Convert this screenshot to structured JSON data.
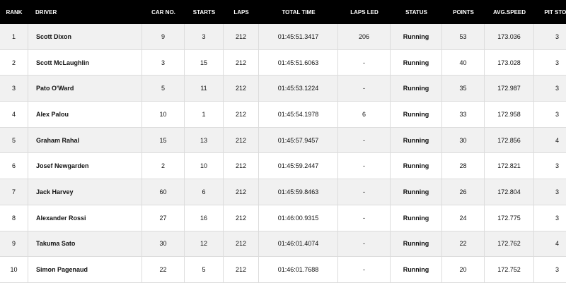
{
  "columns": {
    "rank": "RANK",
    "driver": "DRIVER",
    "car_no": "CAR NO.",
    "starts": "STARTS",
    "laps": "LAPS",
    "total_time": "TOTAL TIME",
    "laps_led": "LAPS LED",
    "status": "STATUS",
    "points": "POINTS",
    "avg_speed": "AVG.SPEED",
    "pit_stop": "PIT STOP"
  },
  "rows": [
    {
      "rank": "1",
      "driver": "Scott Dixon",
      "car_no": "9",
      "starts": "3",
      "laps": "212",
      "total_time": "01:45:51.3417",
      "laps_led": "206",
      "status": "Running",
      "points": "53",
      "avg_speed": "173.036",
      "pit_stop": "3"
    },
    {
      "rank": "2",
      "driver": "Scott McLaughlin",
      "car_no": "3",
      "starts": "15",
      "laps": "212",
      "total_time": "01:45:51.6063",
      "laps_led": "-",
      "status": "Running",
      "points": "40",
      "avg_speed": "173.028",
      "pit_stop": "3"
    },
    {
      "rank": "3",
      "driver": "Pato O'Ward",
      "car_no": "5",
      "starts": "11",
      "laps": "212",
      "total_time": "01:45:53.1224",
      "laps_led": "-",
      "status": "Running",
      "points": "35",
      "avg_speed": "172.987",
      "pit_stop": "3"
    },
    {
      "rank": "4",
      "driver": "Alex Palou",
      "car_no": "10",
      "starts": "1",
      "laps": "212",
      "total_time": "01:45:54.1978",
      "laps_led": "6",
      "status": "Running",
      "points": "33",
      "avg_speed": "172.958",
      "pit_stop": "3"
    },
    {
      "rank": "5",
      "driver": "Graham Rahal",
      "car_no": "15",
      "starts": "13",
      "laps": "212",
      "total_time": "01:45:57.9457",
      "laps_led": "-",
      "status": "Running",
      "points": "30",
      "avg_speed": "172.856",
      "pit_stop": "4"
    },
    {
      "rank": "6",
      "driver": "Josef Newgarden",
      "car_no": "2",
      "starts": "10",
      "laps": "212",
      "total_time": "01:45:59.2447",
      "laps_led": "-",
      "status": "Running",
      "points": "28",
      "avg_speed": "172.821",
      "pit_stop": "3"
    },
    {
      "rank": "7",
      "driver": "Jack Harvey",
      "car_no": "60",
      "starts": "6",
      "laps": "212",
      "total_time": "01:45:59.8463",
      "laps_led": "-",
      "status": "Running",
      "points": "26",
      "avg_speed": "172.804",
      "pit_stop": "3"
    },
    {
      "rank": "8",
      "driver": "Alexander Rossi",
      "car_no": "27",
      "starts": "16",
      "laps": "212",
      "total_time": "01:46:00.9315",
      "laps_led": "-",
      "status": "Running",
      "points": "24",
      "avg_speed": "172.775",
      "pit_stop": "3"
    },
    {
      "rank": "9",
      "driver": "Takuma Sato",
      "car_no": "30",
      "starts": "12",
      "laps": "212",
      "total_time": "01:46:01.4074",
      "laps_led": "-",
      "status": "Running",
      "points": "22",
      "avg_speed": "172.762",
      "pit_stop": "4"
    },
    {
      "rank": "10",
      "driver": "Simon Pagenaud",
      "car_no": "22",
      "starts": "5",
      "laps": "212",
      "total_time": "01:46:01.7688",
      "laps_led": "-",
      "status": "Running",
      "points": "20",
      "avg_speed": "172.752",
      "pit_stop": "3"
    }
  ]
}
